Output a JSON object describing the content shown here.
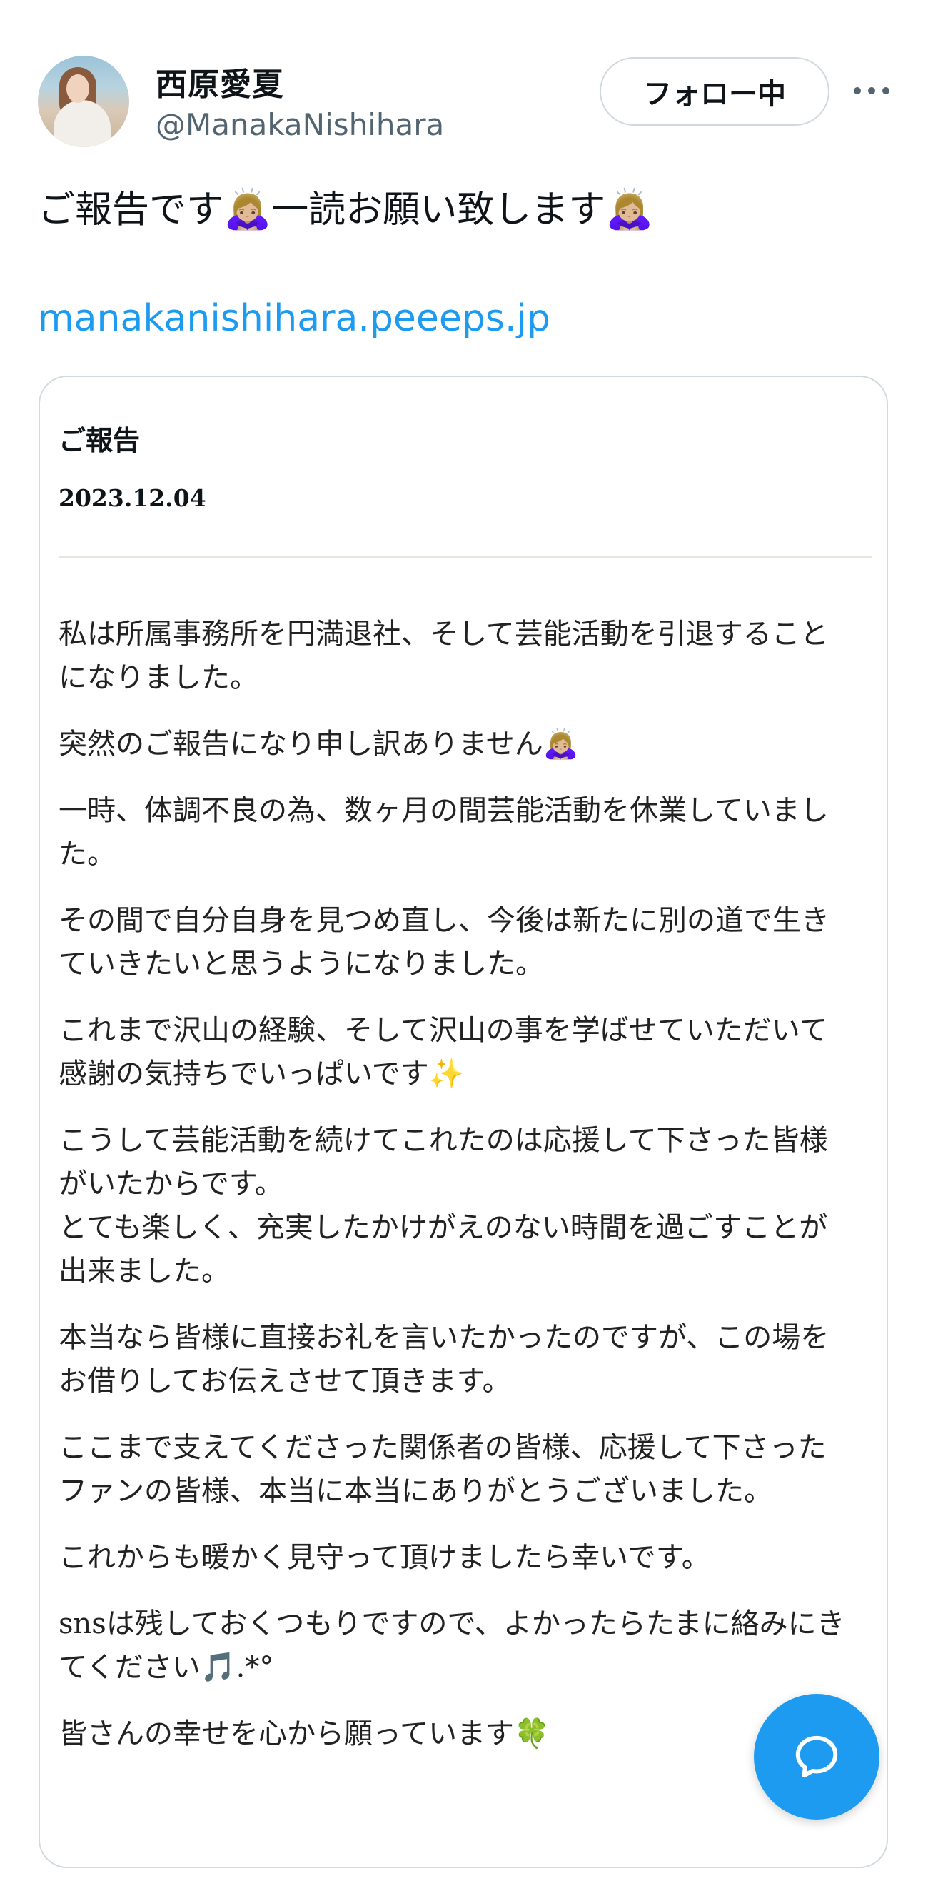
{
  "user": {
    "name": "西原愛夏",
    "handle": "@ManakaNishihara",
    "follow_label": "フォロー中"
  },
  "tweet": {
    "text_part1": "ご報告です",
    "text_part2": "一読お願い致します",
    "emoji": "🙇🏼‍♀️",
    "link": "manakanishihara.peeeps.jp"
  },
  "card": {
    "title": "ご報告",
    "date": "2023.12.04",
    "paragraphs": [
      {
        "lines": [
          "私は所属事務所を円満退社、そして芸能活動を引退すること",
          "になりました。"
        ]
      },
      {
        "lines": [
          "突然のご報告になり申し訳ありません🙇🏼‍♀️"
        ]
      },
      {
        "lines": [
          "一時、体調不良の為、数ヶ月の間芸能活動を休業していまし",
          "た。"
        ]
      },
      {
        "lines": [
          "その間で自分自身を見つめ直し、今後は新たに別の道で生き",
          "ていきたいと思うようになりました。"
        ]
      },
      {
        "lines": [
          "これまで沢山の経験、そして沢山の事を学ばせていただいて",
          "感謝の気持ちでいっぱいです✨"
        ]
      },
      {
        "lines": [
          "こうして芸能活動を続けてこれたのは応援して下さった皆様",
          "がいたからです。",
          "とても楽しく、充実したかけがえのない時間を過ごすことが",
          "出来ました。"
        ]
      },
      {
        "lines": [
          "本当なら皆様に直接お礼を言いたかったのですが、この場を",
          "お借りしてお伝えさせて頂きます。"
        ]
      },
      {
        "lines": [
          "ここまで支えてくださった関係者の皆様、応援して下さった",
          "ファンの皆様、本当に本当にありがとうございました。"
        ]
      },
      {
        "lines": [
          "これからも暖かく見守って頂けましたら幸いです。"
        ]
      },
      {
        "lines": [
          "snsは残しておくつもりですので、よかったらたまに絡みにき",
          "てください🎵.*°"
        ]
      },
      {
        "lines": [
          "皆さんの幸せを心から願っています🍀"
        ]
      }
    ]
  },
  "icons": {
    "more": "more-horizontal-icon",
    "fab": "chat-bubble-icon"
  },
  "colors": {
    "link": "#1d9bf0",
    "fab": "#1d9bf0",
    "secondary_text": "#536471"
  }
}
